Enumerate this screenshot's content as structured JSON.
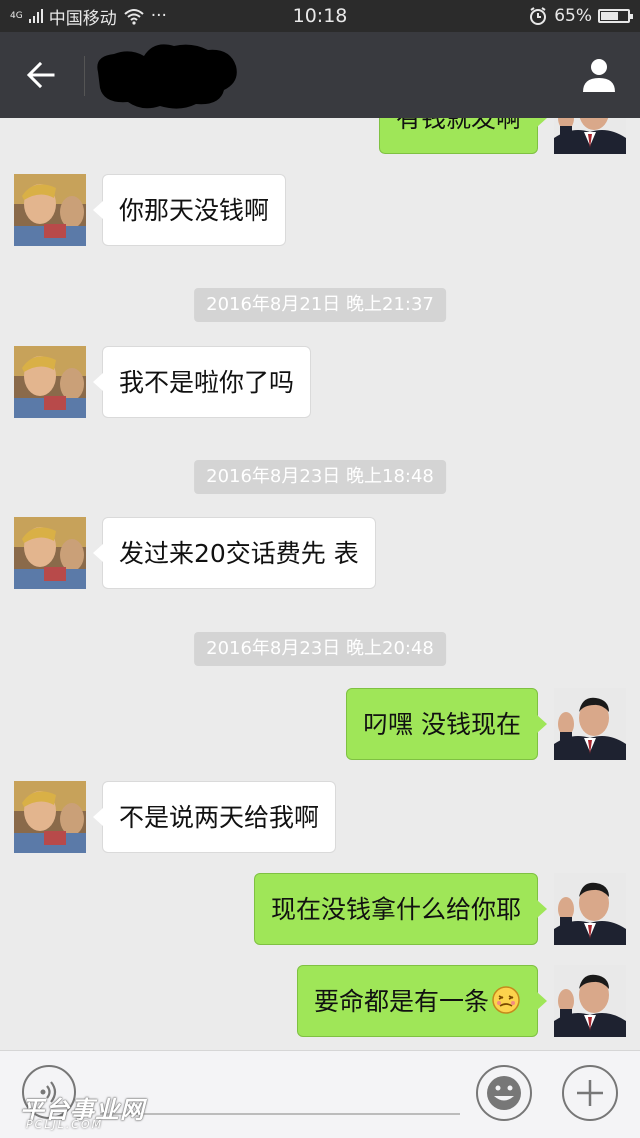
{
  "status_bar": {
    "network": "4G",
    "carrier": "中国移动",
    "more": "···",
    "time": "10:18",
    "battery_percent": "65%",
    "battery_level": 0.65
  },
  "nav": {
    "back_icon": "arrow-left-icon",
    "profile_icon": "person-icon",
    "contact_name_redacted": true
  },
  "messages": [
    {
      "type": "msg",
      "side": "right",
      "text": "有钱就发啊",
      "partial": true
    },
    {
      "type": "msg",
      "side": "left",
      "text": "你那天没钱啊"
    },
    {
      "type": "time",
      "text": "2016年8月21日 晚上21:37"
    },
    {
      "type": "msg",
      "side": "left",
      "text": "我不是啦你了吗"
    },
    {
      "type": "time",
      "text": "2016年8月23日 晚上18:48"
    },
    {
      "type": "msg",
      "side": "left",
      "text": "发过来20交话费先 表"
    },
    {
      "type": "time",
      "text": "2016年8月23日 晚上20:48"
    },
    {
      "type": "msg",
      "side": "right",
      "text": "叼嘿   没钱现在"
    },
    {
      "type": "msg",
      "side": "left",
      "text": "不是说两天给我啊"
    },
    {
      "type": "msg",
      "side": "right",
      "text": "现在没钱拿什么给你耶"
    },
    {
      "type": "msg",
      "side": "right",
      "text": "要命都是有一条",
      "emoji": "sick-face-emoji"
    }
  ],
  "input_bar": {
    "voice_icon": "voice-icon",
    "emoji_icon": "smiley-icon",
    "plus_icon": "plus-icon"
  },
  "watermark": {
    "main": "平台事业网",
    "sub": "PCLJL.COM"
  },
  "colors": {
    "chat_bg": "#ebebeb",
    "nav_bg": "#393a3f",
    "sent_bubble": "#9fe658",
    "received_bubble": "#ffffff"
  }
}
